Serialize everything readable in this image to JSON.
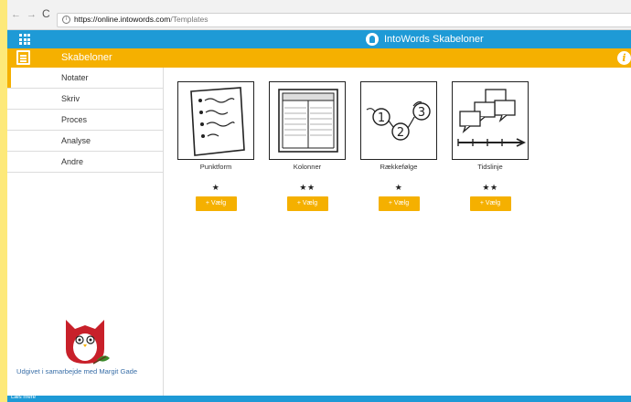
{
  "browser": {
    "url_host": "https://online.intowords.com",
    "url_path": "/Templates",
    "back_icon": "arrow-left-icon",
    "forward_icon": "arrow-right-icon",
    "reload_icon": "reload-icon"
  },
  "appbar": {
    "title": "IntoWords Skabeloner",
    "menu_icon": "grid-icon"
  },
  "section": {
    "title": "Skabeloner",
    "info": "i"
  },
  "sidebar": {
    "items": [
      {
        "label": "Notater"
      },
      {
        "label": "Skriv"
      },
      {
        "label": "Proces"
      },
      {
        "label": "Analyse"
      },
      {
        "label": "Andre"
      }
    ],
    "credit": "Udgivet i samarbejde med Margit Gade"
  },
  "templates": [
    {
      "label": "Punktform",
      "stars": "★",
      "button": "+ Vælg",
      "icon": "bullet-list-icon"
    },
    {
      "label": "Kolonner",
      "stars": "★★",
      "button": "+ Vælg",
      "icon": "columns-icon"
    },
    {
      "label": "Rækkefølge",
      "stars": "★",
      "button": "+ Vælg",
      "icon": "sequence-icon"
    },
    {
      "label": "Tidslinje",
      "stars": "★★",
      "button": "+ Vælg",
      "icon": "timeline-icon"
    }
  ],
  "footer": {
    "text": "Læs mere"
  },
  "colors": {
    "blue": "#1e9ad6",
    "orange": "#f5b000",
    "credit": "#3a6fa8"
  }
}
